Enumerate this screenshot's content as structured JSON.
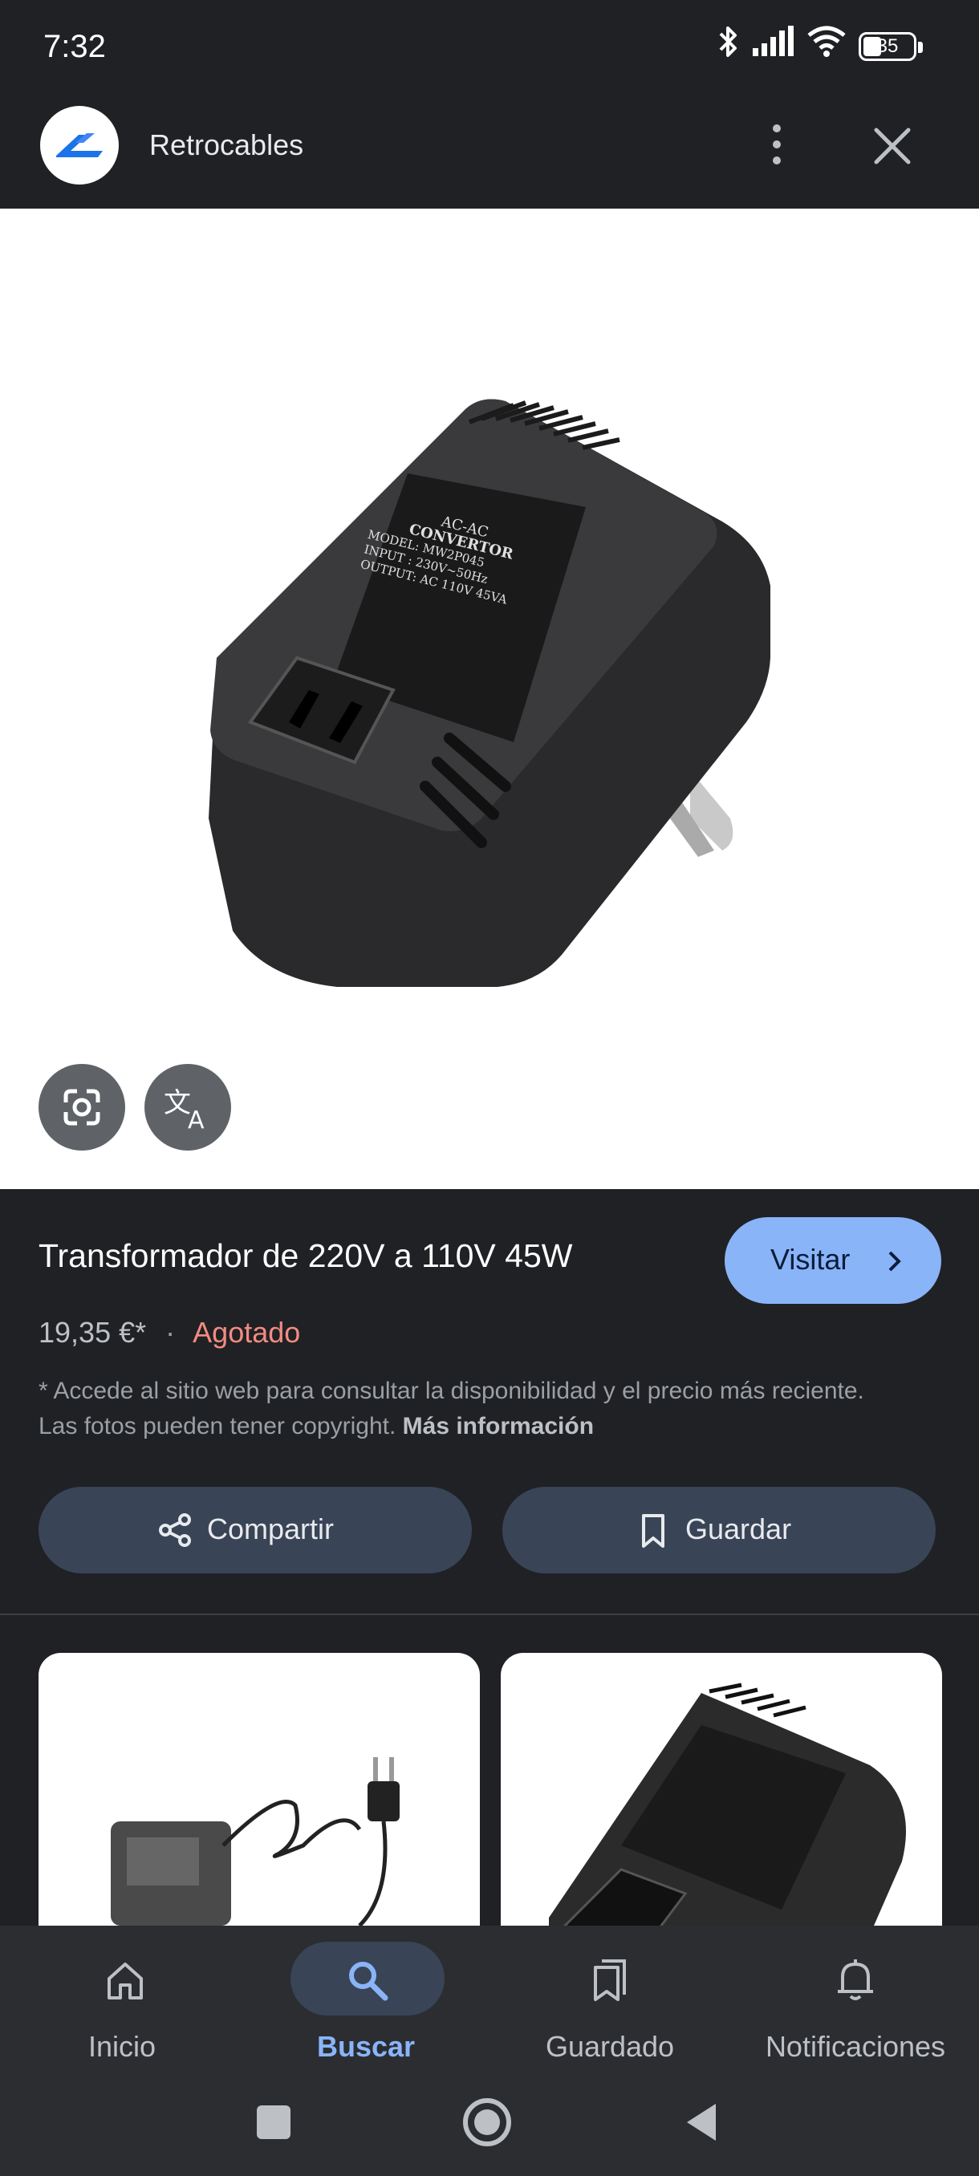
{
  "status_bar": {
    "time": "7:32",
    "battery": "35",
    "icons": [
      "bluetooth-icon",
      "signal-icon",
      "wifi-icon",
      "battery-icon"
    ]
  },
  "header": {
    "site_name": "Retrocables",
    "icons": [
      "site-logo",
      "more-vert-icon",
      "close-icon"
    ]
  },
  "image_panel": {
    "product_label_lines": [
      "AC-AC",
      "CONVERTOR",
      "MODEL: MW2P045",
      "INPUT : 230V~50Hz",
      "OUTPUT: AC 110V 45VA"
    ],
    "buttons": [
      "google-lens-icon",
      "translate-icon"
    ]
  },
  "product": {
    "title": "Transformador de 220V a 110V 45W",
    "visit_label": "Visitar",
    "price": "19,35 €*",
    "separator": "·",
    "stock": "Agotado",
    "disclaimer": "* Accede al sitio web para consultar la disponibilidad y el precio más reciente. Las fotos pueden tener copyright.",
    "more_info": "Más información",
    "share_label": "Compartir",
    "save_label": "Guardar"
  },
  "colors": {
    "background": "#202124",
    "accent_blue": "#8ab4f8",
    "stock_red": "#f28b82",
    "pill_bg": "#394457"
  },
  "bottom_nav": {
    "items": [
      {
        "label": "Inicio",
        "icon": "home-icon"
      },
      {
        "label": "Buscar",
        "icon": "search-icon",
        "active": true
      },
      {
        "label": "Guardado",
        "icon": "bookmarks-icon"
      },
      {
        "label": "Notificaciones",
        "icon": "bell-icon"
      }
    ]
  }
}
